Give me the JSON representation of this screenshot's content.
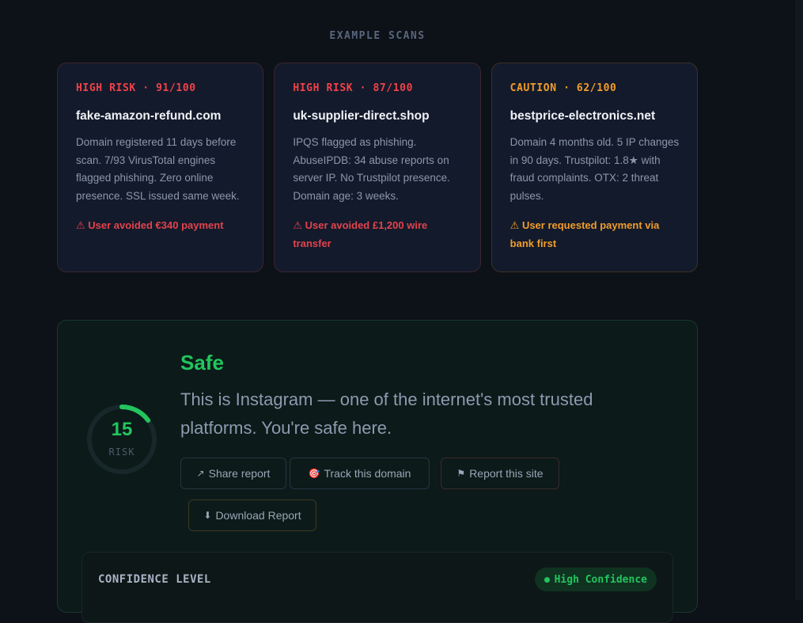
{
  "section_label": "EXAMPLE SCANS",
  "cards": [
    {
      "tag": "HIGH RISK · 91/100",
      "domain": "fake-amazon-refund.com",
      "description": "Domain registered 11 days before scan. 7/93 VirusTotal engines flagged phishing. Zero online presence. SSL issued same week.",
      "outcome_icon": "⚠",
      "outcome": "User avoided €340 payment",
      "level": "high"
    },
    {
      "tag": "HIGH RISK · 87/100",
      "domain": "uk-supplier-direct.shop",
      "description": "IPQS flagged as phishing. AbuseIPDB: 34 abuse reports on server IP. No Trustpilot presence. Domain age: 3 weeks.",
      "outcome_icon": "⚠",
      "outcome": "User avoided £1,200 wire transfer",
      "level": "high"
    },
    {
      "tag": "CAUTION · 62/100",
      "domain": "bestprice-electronics.net",
      "description": "Domain 4 months old. 5 IP changes in 90 days. Trustpilot: 1.8★ with fraud complaints. OTX: 2 threat pulses.",
      "outcome_icon": "⚠",
      "outcome": "User requested payment via bank first",
      "level": "caution"
    }
  ],
  "result": {
    "verdict": "Safe",
    "summary": "This is Instagram — one of the internet's most trusted platforms. You're safe here.",
    "risk_score": "15",
    "risk_score_value": 15,
    "risk_max": 100,
    "risk_label": "RISK",
    "accent_color": "#22c55e",
    "actions": {
      "share_icon": "↗",
      "share": "Share report",
      "track_icon": "🎯",
      "track": "Track this domain",
      "report_icon": "⚑",
      "report": "Report this site",
      "download_icon": "⬇",
      "download": "Download Report"
    },
    "confidence": {
      "label": "CONFIDENCE LEVEL",
      "badge": "High Confidence"
    }
  }
}
